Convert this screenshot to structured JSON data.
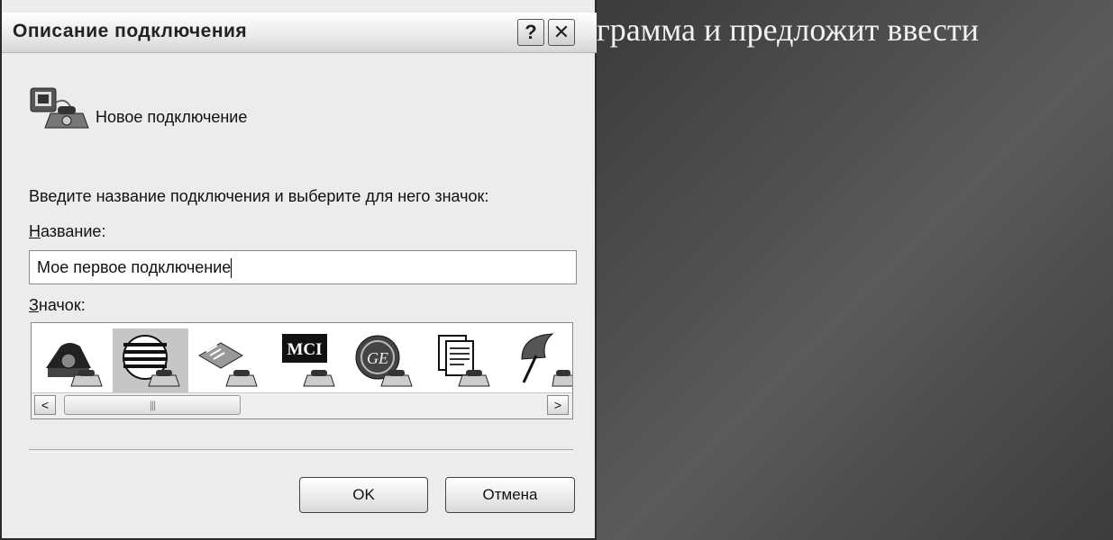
{
  "slide": {
    "text": "грамма и предложит ввести"
  },
  "dialog": {
    "title": "Описание подключения",
    "help_symbol": "?",
    "close_symbol": "✕",
    "connection_name": "Новое подключение",
    "prompt": "Введите название подключения и выберите для него значок:",
    "name_label": "Название:",
    "name_value": "Мое первое подключение",
    "icon_label": "Значок:",
    "icons": [
      {
        "name": "phone-icon",
        "selected": false
      },
      {
        "name": "globe-icon",
        "selected": true
      },
      {
        "name": "fax-icon",
        "selected": false
      },
      {
        "name": "mci-icon",
        "selected": false,
        "text": "MCI"
      },
      {
        "name": "ge-icon",
        "selected": false,
        "text": "GE"
      },
      {
        "name": "documents-icon",
        "selected": false
      },
      {
        "name": "umbrella-icon",
        "selected": false
      }
    ],
    "scroll_left": "<",
    "scroll_right": ">",
    "scroll_thumb_grip": "|||",
    "ok_label": "OK",
    "cancel_label": "Отмена"
  }
}
